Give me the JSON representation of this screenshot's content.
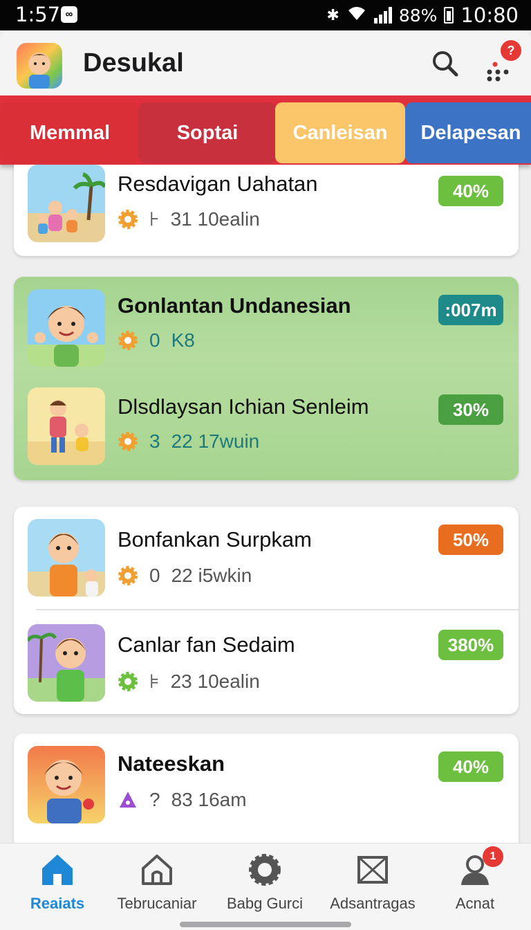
{
  "status_bar": {
    "time": "1:57",
    "battery": "88%",
    "clock": "10:80"
  },
  "app": {
    "title": "Desukal",
    "help_badge": "?"
  },
  "tabs": [
    {
      "label": "Memmal"
    },
    {
      "label": "Soptai"
    },
    {
      "label": "Canleisan"
    },
    {
      "label": "Delapesan"
    }
  ],
  "items": [
    {
      "title": "Resdavigan Uahatan",
      "meta_a": "⊦",
      "meta_b": "31 10ealin",
      "badge": "40%",
      "badge_color": "#6cbf3f",
      "icon_color": "#f0a032"
    },
    {
      "title": "Gonlantan Undanesian",
      "meta_a": "0",
      "meta_b": "K8",
      "badge": ":007m",
      "badge_color": "#1e8a8a",
      "icon_color": "#f0a032"
    },
    {
      "title": "Dlsdlaysan Ichian Senleim",
      "meta_a": "3",
      "meta_b": "22 17wuin",
      "badge": "30%",
      "badge_color": "#4aa040",
      "icon_color": "#f0a032"
    },
    {
      "title": "Bonfankan Surpkam",
      "meta_a": "0",
      "meta_b": "22 i5wkin",
      "badge": "50%",
      "badge_color": "#e86d1f",
      "icon_color": "#f0a032"
    },
    {
      "title": "Canlar fan Sedaim",
      "meta_a": "⊧",
      "meta_b": "23 10ealin",
      "badge": "380%",
      "badge_color": "#6cbf3f",
      "icon_color": "#6cbf3f"
    },
    {
      "title": "Nateeskan",
      "meta_a": "?",
      "meta_b": "83 16am",
      "badge": "40%",
      "badge_color": "#6cbf3f",
      "icon_color": "#9b4fd0"
    }
  ],
  "bottom_nav": [
    {
      "label": "Reaiats",
      "icon": "home-filled-icon"
    },
    {
      "label": "Tebrucaniar",
      "icon": "home-outline-icon"
    },
    {
      "label": "Babg Gurci",
      "icon": "gear-badge-icon"
    },
    {
      "label": "Adsantragas",
      "icon": "mail-icon"
    },
    {
      "label": "Acnat",
      "icon": "person-icon",
      "badge": "1"
    }
  ],
  "colors": {
    "accent": "#1e88d6",
    "tab_red": "#db2f38",
    "tab_yellow": "#fbc66a",
    "tab_blue": "#3d73c4"
  }
}
